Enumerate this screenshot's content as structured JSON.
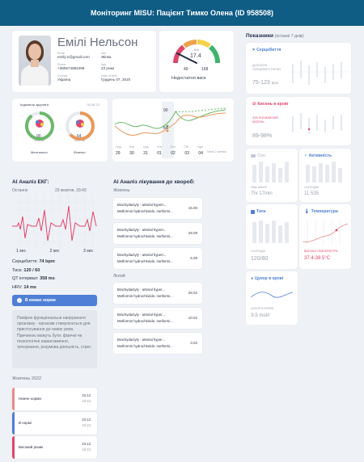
{
  "header": {
    "title": "Моніторинг MISU: Пацієнт Тимко Олена (ID 958508)"
  },
  "patient": {
    "name": "Емілі Нельсон",
    "email_label": "Email",
    "email": "emily.n@gmail.com",
    "phone_label": "Phone",
    "phone": "+380674982499",
    "country_label": "Country",
    "country": "Україна",
    "sex_label": "Sex",
    "sex": "Жінка",
    "age_label": "Age",
    "age": "23 роки",
    "birth_label": "Date of birth",
    "birth": "Грудень 07, 2020"
  },
  "bmi": {
    "label": "BMI",
    "value": "17.4",
    "left": "49",
    "right": "168",
    "status": "Недостатня вага"
  },
  "health": {
    "title": "Індикатор здоров'я",
    "date": "05.08.23",
    "gauges": [
      {
        "value": "90",
        "sub": "out of 100",
        "label": "Ментально"
      },
      {
        "value": "64",
        "sub": "out of 100",
        "label": "Фізично"
      }
    ]
  },
  "week_chart": {
    "days": [
      "Пнд",
      "Втр",
      "Срд",
      "Чтв",
      "Птн",
      "Сбт",
      "Ндл"
    ],
    "dates": [
      "29",
      "30",
      "31",
      "01",
      "02",
      "03",
      "04"
    ],
    "label_top": "90",
    "label_bottom": "64",
    "next": "Next 2 weeks"
  },
  "ecg": {
    "title": "AI Аналіз ЕКГ:",
    "period_label": "Останнє",
    "date": "23 жовтня, 18:43",
    "ticks": [
      "1 sec",
      "2 sec",
      "3 sec"
    ],
    "hr_label": "Серцебиття:",
    "hr": "74 bpm",
    "bp_label": "Тиск:",
    "bp": "120 / 60",
    "qt_label": "QT інтервал:",
    "qt": "358 ms",
    "hrv_label": "HRV:",
    "hrv": "14 ms",
    "badge": "В межах норми",
    "description": "Помірне функціональне напруження організму - організм стимулюється для пристосування до нових умов. Причиною можуть бути: фізичні чи психологічні навантаження, тренування, розумова діяльність, стрес"
  },
  "history": {
    "month": "Жовтень 2022",
    "items": [
      {
        "label": "Нижче норми",
        "date": "23.12",
        "time": "18:43",
        "color": "#e88a8a"
      },
      {
        "label": "В нормі",
        "date": "23.12",
        "time": "18:43",
        "color": "#4f7fd6"
      },
      {
        "label": "Високий ризик",
        "date": "23.12",
        "time": "18:43",
        "color": "#e0456b"
      }
    ]
  },
  "treatment": {
    "title": "AI Аналіз лікування до хвороб:",
    "groups": [
      {
        "month": "Жовтень",
        "items": [
          {
            "name": "Brachydactyly - arterial hypert...",
            "med": "Metformin hydrochloride, metformi...",
            "date": "15.00"
          },
          {
            "name": "Brachydactyly - arterial hypert...",
            "med": "Metformin hydrochloride, metformi...",
            "date": "29.09"
          },
          {
            "name": "Brachydactyly - arterial hypert...",
            "med": "Metformin hydrochloride, metformi...",
            "date": "5.09"
          }
        ]
      },
      {
        "month": "Лютий",
        "items": [
          {
            "name": "Brachydactyly - arterial hyper...",
            "med": "Metformin hydrochloride, metformi...",
            "date": "28.02"
          },
          {
            "name": "Brachydactyly - arterial hyper...",
            "med": "Metformin hydrochloride, metformi...",
            "date": "10.02"
          },
          {
            "name": "Brachydactyly - arterial hyper...",
            "med": "Metformin hydrochloride, metformi...",
            "date": "3.02"
          }
        ]
      }
    ]
  },
  "indicators": {
    "title": "Показники",
    "subtitle": "(останні 7 днів):",
    "heart": {
      "title": "Серцебиття",
      "desc": "ДІАПАЗОН СЕРЦЕВОГО РИТМУ",
      "value": "75-123",
      "unit": "bpm"
    },
    "oxygen": {
      "title": "Кисень в крові",
      "desc": "ЗУВ ПОНИЖЕНИЙ КИСЕНЬ",
      "value": "89-98%"
    },
    "sleep": {
      "title": "Сон",
      "desc": "ПМК АКЬЕР",
      "value": "7hr 17min"
    },
    "activity": {
      "title": "Активність",
      "desc": "СЬОГОДНІ",
      "value": "11 535"
    },
    "pressure": {
      "title": "Тиск",
      "desc": "СЬОГОДНІ",
      "value": "120/80"
    },
    "temperature": {
      "title": "Температура",
      "desc": "ВИСОКА ТЕМПЕРАТУРА",
      "value": "37.4-38.5°C"
    },
    "sugar": {
      "title": "Цукор в крові",
      "desc": "ЦУКОР В НОРМІ",
      "value": "3-5 mol/l"
    }
  }
}
